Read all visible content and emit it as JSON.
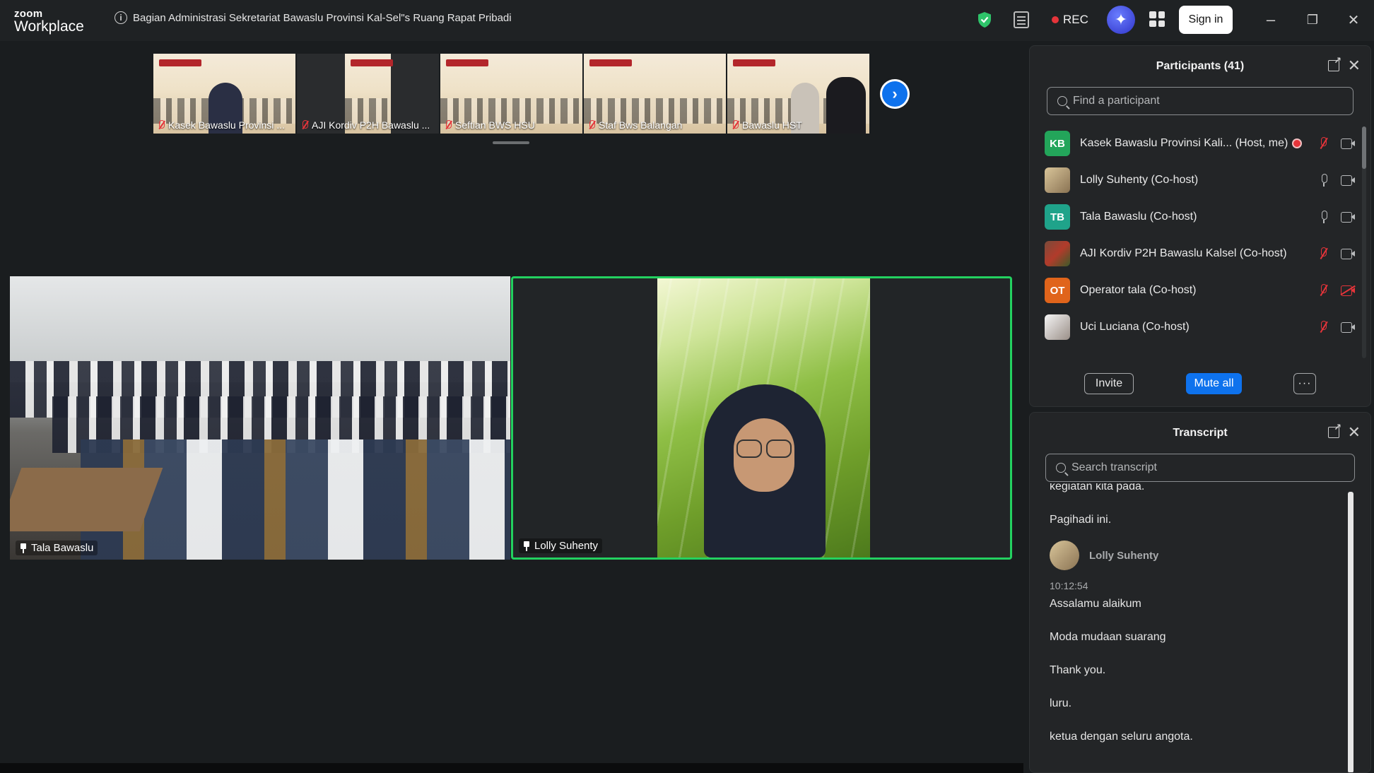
{
  "app": {
    "logo_top": "zoom",
    "logo_bottom": "Workplace",
    "meeting_title": "Bagian Administrasi Sekretariat Bawaslu Provinsi Kal-Sel\"s Ruang Rapat Pribadi",
    "rec_label": "REC",
    "signin_label": "Sign in",
    "minimize": "–",
    "restore": "❐",
    "close": "✕"
  },
  "strip": {
    "thumbnails": [
      {
        "label": "Kasek Bawaslu Provinsi ..."
      },
      {
        "label": "AJI Kordiv P2H Bawaslu ..."
      },
      {
        "label": "Seftian BWS HSU"
      },
      {
        "label": "Staf Bws Balangan"
      },
      {
        "label": "Bawaslu HST"
      }
    ],
    "next_icon": "›"
  },
  "videos": {
    "left_label": "Tala Bawaslu",
    "right_label": "Lolly Suhenty"
  },
  "participants": {
    "title": "Participants (41)",
    "search_placeholder": "Find a participant",
    "rows": [
      {
        "initials": "KB",
        "name": "Kasek Bawaslu Provinsi Kali...  (Host, me)",
        "color": "#23a55a"
      },
      {
        "initials": "",
        "name": "Lolly Suhenty (Co-host)",
        "color": ""
      },
      {
        "initials": "TB",
        "name": "Tala Bawaslu (Co-host)",
        "color": "#1fa38a"
      },
      {
        "initials": "",
        "name": "AJI Kordiv P2H Bawaslu Kalsel (Co-host)",
        "color": ""
      },
      {
        "initials": "OT",
        "name": "Operator tala (Co-host)",
        "color": "#e0641b"
      },
      {
        "initials": "",
        "name": "Uci Luciana (Co-host)",
        "color": ""
      }
    ],
    "invite_label": "Invite",
    "mute_all_label": "Mute all",
    "more_label": "···"
  },
  "transcript": {
    "title": "Transcript",
    "search_placeholder": "Search transcript",
    "lines_before": [
      "kegiatan kita pada.",
      "Pagihadi ini."
    ],
    "speaker": "Lolly Suhenty",
    "time": "10:12:54",
    "lines_after": [
      "Assalamu alaikum",
      "Moda mudaan suarang",
      "Thank you.",
      "luru.",
      "ketua dengan seluru angota."
    ]
  },
  "colors": {
    "accent": "#0e72ed",
    "active_speaker": "#23d160",
    "recording": "#e5343a"
  }
}
